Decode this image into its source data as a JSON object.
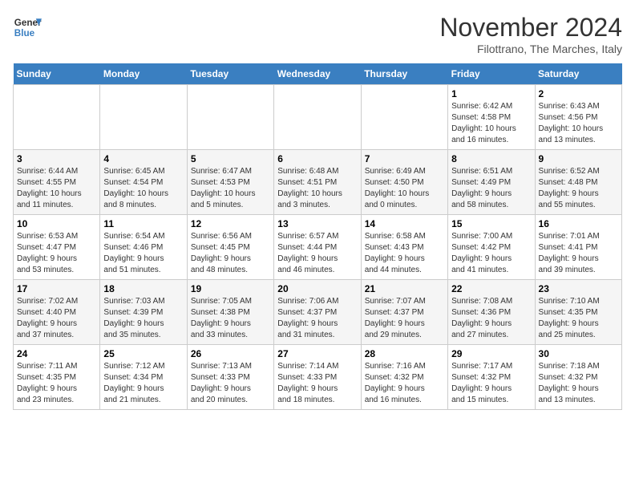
{
  "logo": {
    "line1": "General",
    "line2": "Blue"
  },
  "title": "November 2024",
  "subtitle": "Filottrano, The Marches, Italy",
  "weekdays": [
    "Sunday",
    "Monday",
    "Tuesday",
    "Wednesday",
    "Thursday",
    "Friday",
    "Saturday"
  ],
  "weeks": [
    [
      {
        "day": "",
        "info": ""
      },
      {
        "day": "",
        "info": ""
      },
      {
        "day": "",
        "info": ""
      },
      {
        "day": "",
        "info": ""
      },
      {
        "day": "",
        "info": ""
      },
      {
        "day": "1",
        "info": "Sunrise: 6:42 AM\nSunset: 4:58 PM\nDaylight: 10 hours\nand 16 minutes."
      },
      {
        "day": "2",
        "info": "Sunrise: 6:43 AM\nSunset: 4:56 PM\nDaylight: 10 hours\nand 13 minutes."
      }
    ],
    [
      {
        "day": "3",
        "info": "Sunrise: 6:44 AM\nSunset: 4:55 PM\nDaylight: 10 hours\nand 11 minutes."
      },
      {
        "day": "4",
        "info": "Sunrise: 6:45 AM\nSunset: 4:54 PM\nDaylight: 10 hours\nand 8 minutes."
      },
      {
        "day": "5",
        "info": "Sunrise: 6:47 AM\nSunset: 4:53 PM\nDaylight: 10 hours\nand 5 minutes."
      },
      {
        "day": "6",
        "info": "Sunrise: 6:48 AM\nSunset: 4:51 PM\nDaylight: 10 hours\nand 3 minutes."
      },
      {
        "day": "7",
        "info": "Sunrise: 6:49 AM\nSunset: 4:50 PM\nDaylight: 10 hours\nand 0 minutes."
      },
      {
        "day": "8",
        "info": "Sunrise: 6:51 AM\nSunset: 4:49 PM\nDaylight: 9 hours\nand 58 minutes."
      },
      {
        "day": "9",
        "info": "Sunrise: 6:52 AM\nSunset: 4:48 PM\nDaylight: 9 hours\nand 55 minutes."
      }
    ],
    [
      {
        "day": "10",
        "info": "Sunrise: 6:53 AM\nSunset: 4:47 PM\nDaylight: 9 hours\nand 53 minutes."
      },
      {
        "day": "11",
        "info": "Sunrise: 6:54 AM\nSunset: 4:46 PM\nDaylight: 9 hours\nand 51 minutes."
      },
      {
        "day": "12",
        "info": "Sunrise: 6:56 AM\nSunset: 4:45 PM\nDaylight: 9 hours\nand 48 minutes."
      },
      {
        "day": "13",
        "info": "Sunrise: 6:57 AM\nSunset: 4:44 PM\nDaylight: 9 hours\nand 46 minutes."
      },
      {
        "day": "14",
        "info": "Sunrise: 6:58 AM\nSunset: 4:43 PM\nDaylight: 9 hours\nand 44 minutes."
      },
      {
        "day": "15",
        "info": "Sunrise: 7:00 AM\nSunset: 4:42 PM\nDaylight: 9 hours\nand 41 minutes."
      },
      {
        "day": "16",
        "info": "Sunrise: 7:01 AM\nSunset: 4:41 PM\nDaylight: 9 hours\nand 39 minutes."
      }
    ],
    [
      {
        "day": "17",
        "info": "Sunrise: 7:02 AM\nSunset: 4:40 PM\nDaylight: 9 hours\nand 37 minutes."
      },
      {
        "day": "18",
        "info": "Sunrise: 7:03 AM\nSunset: 4:39 PM\nDaylight: 9 hours\nand 35 minutes."
      },
      {
        "day": "19",
        "info": "Sunrise: 7:05 AM\nSunset: 4:38 PM\nDaylight: 9 hours\nand 33 minutes."
      },
      {
        "day": "20",
        "info": "Sunrise: 7:06 AM\nSunset: 4:37 PM\nDaylight: 9 hours\nand 31 minutes."
      },
      {
        "day": "21",
        "info": "Sunrise: 7:07 AM\nSunset: 4:37 PM\nDaylight: 9 hours\nand 29 minutes."
      },
      {
        "day": "22",
        "info": "Sunrise: 7:08 AM\nSunset: 4:36 PM\nDaylight: 9 hours\nand 27 minutes."
      },
      {
        "day": "23",
        "info": "Sunrise: 7:10 AM\nSunset: 4:35 PM\nDaylight: 9 hours\nand 25 minutes."
      }
    ],
    [
      {
        "day": "24",
        "info": "Sunrise: 7:11 AM\nSunset: 4:35 PM\nDaylight: 9 hours\nand 23 minutes."
      },
      {
        "day": "25",
        "info": "Sunrise: 7:12 AM\nSunset: 4:34 PM\nDaylight: 9 hours\nand 21 minutes."
      },
      {
        "day": "26",
        "info": "Sunrise: 7:13 AM\nSunset: 4:33 PM\nDaylight: 9 hours\nand 20 minutes."
      },
      {
        "day": "27",
        "info": "Sunrise: 7:14 AM\nSunset: 4:33 PM\nDaylight: 9 hours\nand 18 minutes."
      },
      {
        "day": "28",
        "info": "Sunrise: 7:16 AM\nSunset: 4:32 PM\nDaylight: 9 hours\nand 16 minutes."
      },
      {
        "day": "29",
        "info": "Sunrise: 7:17 AM\nSunset: 4:32 PM\nDaylight: 9 hours\nand 15 minutes."
      },
      {
        "day": "30",
        "info": "Sunrise: 7:18 AM\nSunset: 4:32 PM\nDaylight: 9 hours\nand 13 minutes."
      }
    ]
  ]
}
